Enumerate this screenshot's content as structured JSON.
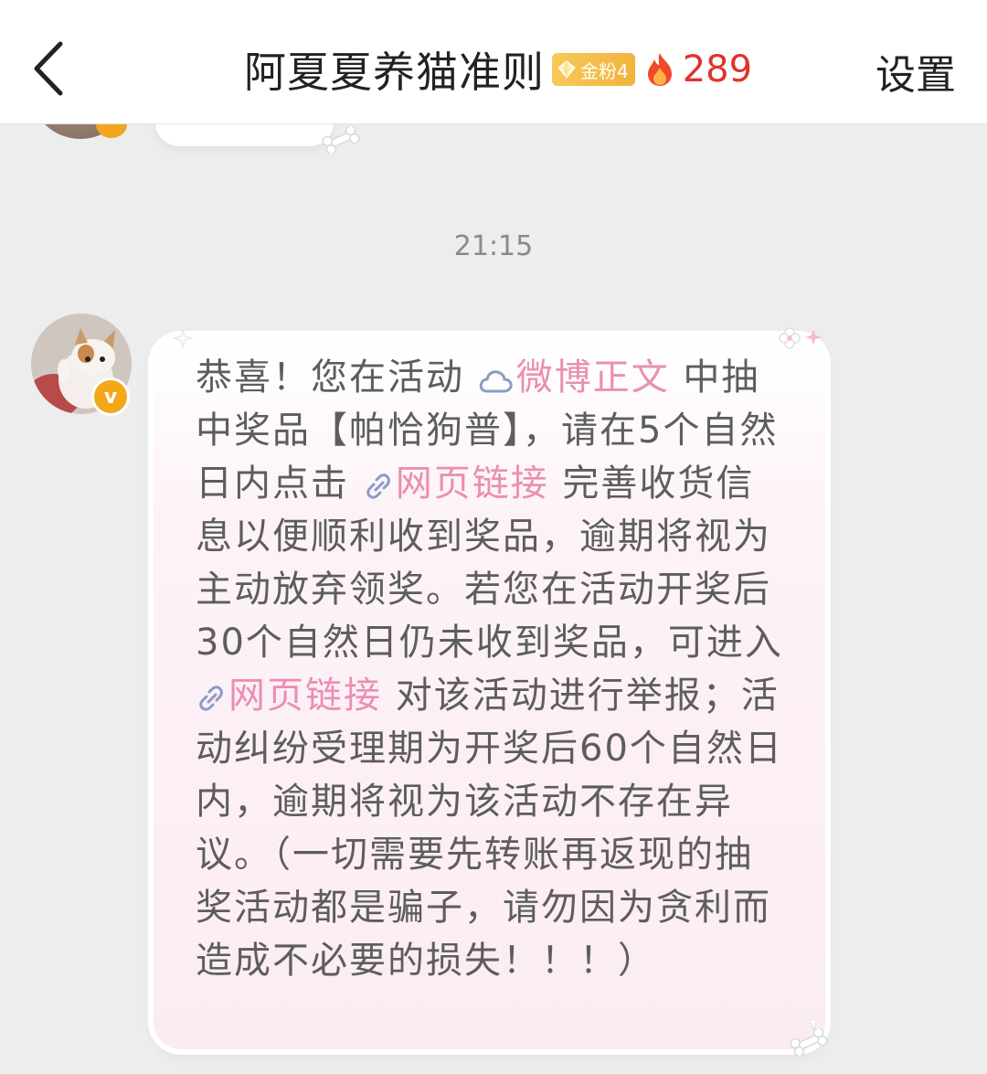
{
  "header": {
    "title": "阿夏夏养猫准则",
    "fan_badge": "金粉4",
    "intimacy_count": "289",
    "settings_label": "设置"
  },
  "chat": {
    "timestamp": "21:15",
    "verified_mark": "v",
    "message": {
      "seg1": "恭喜！您在活动 ",
      "link1": "微博正文",
      "seg2": " 中抽中奖品【帕恰狗普】，请在5个自然日内点击 ",
      "link2": "网页链接",
      "seg3": " 完善收货信息以便顺利收到奖品，逾期将视为主动放弃领奖。若您在活动开奖后30个自然日仍未收到奖品，可进入 ",
      "link3": "网页链接",
      "seg4": " 对该活动进行举报；活动纠纷受理期为开奖后60个自然日内，逾期将视为该活动不存在异议。（一切需要先转账再返现的抽奖活动都是骗子，请勿因为贪利而造成不必要的损失！！！）"
    }
  },
  "colors": {
    "link": "#ea8fb2",
    "intimacy": "#e0332b",
    "badge": "#f2b33c"
  }
}
